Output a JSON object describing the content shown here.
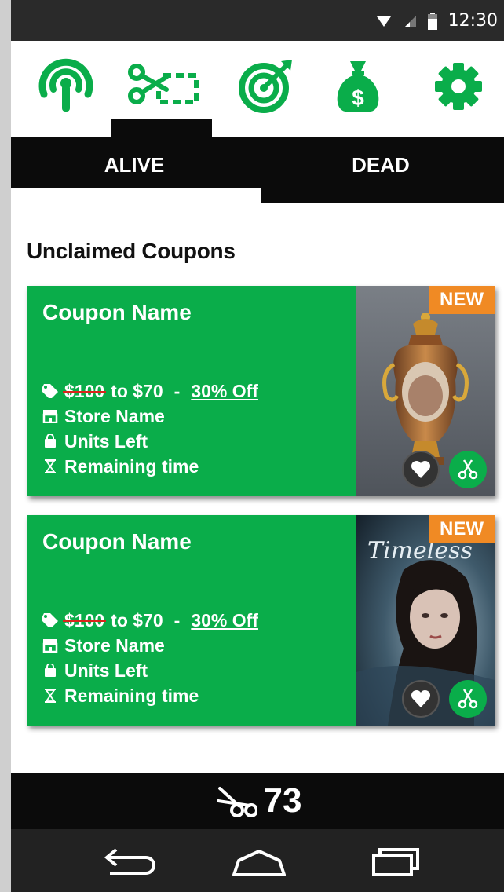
{
  "status_bar": {
    "time": "12:30",
    "icons": [
      "wifi-icon",
      "signal-icon",
      "battery-icon"
    ]
  },
  "top_nav": {
    "icons": [
      "broadcast-icon",
      "coupon-scissors-icon",
      "target-icon",
      "money-bag-icon",
      "settings-gear-icon"
    ],
    "active_index": 1,
    "accent_color": "#0aad4a"
  },
  "tabs": [
    {
      "label": "ALIVE",
      "active": true
    },
    {
      "label": "DEAD",
      "active": false
    }
  ],
  "section_title": "Unclaimed Coupons",
  "coupons": [
    {
      "name": "Coupon Name",
      "old_price": "$100",
      "to_text": "to $70",
      "dash": "-",
      "discount": "30% Off",
      "store": "Store Name",
      "units": "Units Left",
      "time": "Remaining time",
      "badge": "NEW",
      "image": "ornate-vase"
    },
    {
      "name": "Coupon Name",
      "old_price": "$100",
      "to_text": "to $70",
      "dash": "-",
      "discount": "30% Off",
      "store": "Store Name",
      "units": "Units Left",
      "time": "Remaining time",
      "badge": "NEW",
      "image": "timeless-book-cover",
      "image_text": "Timeless"
    }
  ],
  "bottom_bar": {
    "count": "73",
    "icon": "scissors-icon"
  },
  "system_nav": [
    "back-icon",
    "home-icon",
    "recents-icon"
  ],
  "colors": {
    "green": "#0aad4a",
    "orange": "#f08a24",
    "black": "#0b0b0b",
    "strike": "#d9261c"
  }
}
